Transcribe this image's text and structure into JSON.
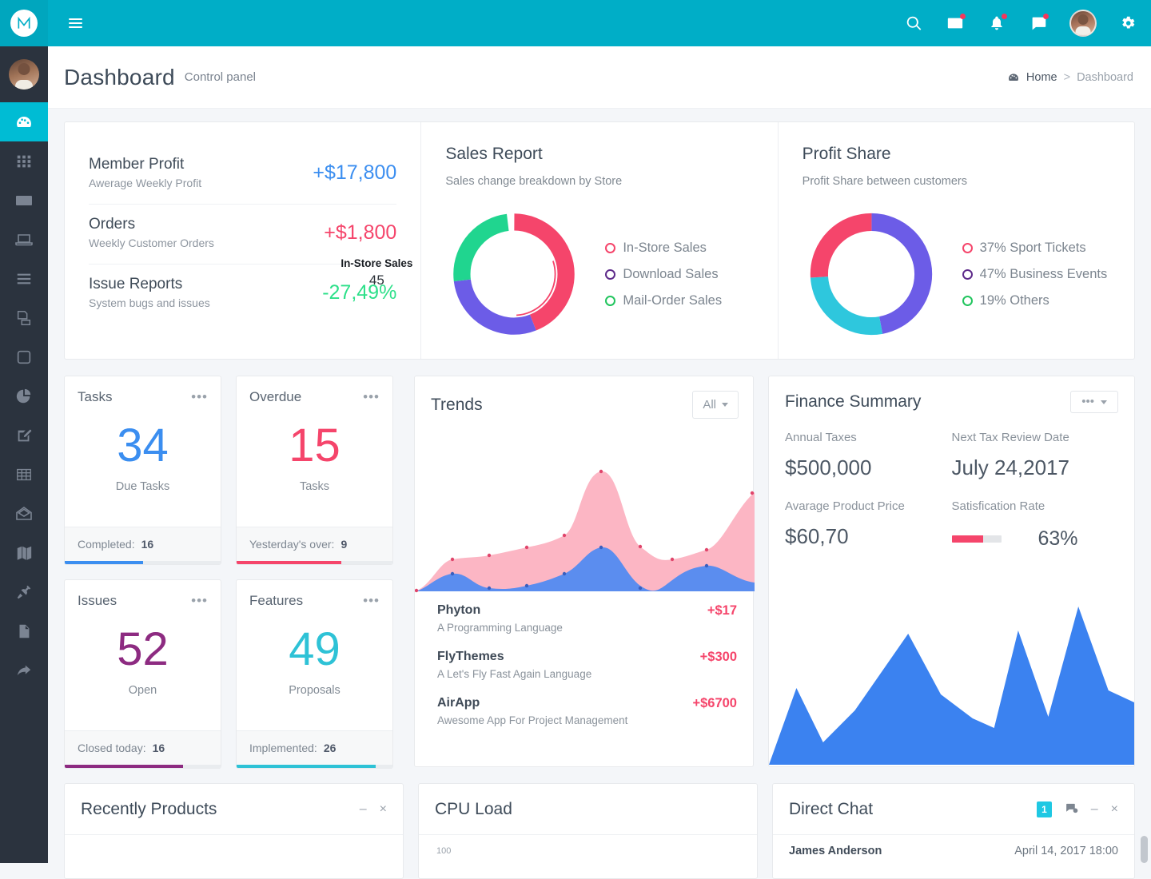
{
  "navbar": {
    "logo_name": "brand-logo",
    "icons": [
      "search-icon",
      "envelope-icon",
      "bell-icon",
      "chat-icon",
      "gear-icon"
    ],
    "brand_color": "#00aec7"
  },
  "sidebar": {
    "items": [
      {
        "icon": "dashboard-icon",
        "active": true
      },
      {
        "icon": "grid-icon",
        "active": false
      },
      {
        "icon": "envelope-icon",
        "active": false
      },
      {
        "icon": "laptop-icon",
        "active": false
      },
      {
        "icon": "bars-icon",
        "active": false
      },
      {
        "icon": "copy-icon",
        "active": false
      },
      {
        "icon": "square-icon",
        "active": false
      },
      {
        "icon": "pie-chart-icon",
        "active": false
      },
      {
        "icon": "edit-icon",
        "active": false
      },
      {
        "icon": "table-icon",
        "active": false
      },
      {
        "icon": "open-envelope-icon",
        "active": false
      },
      {
        "icon": "map-icon",
        "active": false
      },
      {
        "icon": "plug-icon",
        "active": false
      },
      {
        "icon": "file-icon",
        "active": false
      },
      {
        "icon": "share-icon",
        "active": false
      }
    ]
  },
  "header": {
    "title": "Dashboard",
    "subtitle": "Control panel",
    "breadcrumb": {
      "home": "Home",
      "separator": ">",
      "current": "Dashboard"
    }
  },
  "stats": [
    {
      "name": "Member Profit",
      "desc": "Awerage Weekly Profit",
      "value": "+$17,800",
      "color": "#3b8ef0"
    },
    {
      "name": "Orders",
      "desc": "Weekly Customer Orders",
      "value": "+$1,800",
      "color": "#f5456b"
    },
    {
      "name": "Issue Reports",
      "desc": "System bugs and issues",
      "value": "-27,49%",
      "color": "#2ee08a"
    }
  ],
  "sales_report": {
    "title": "Sales Report",
    "subtitle": "Sales change breakdown by Store",
    "center_label": "In-Store Sales",
    "center_value": "45",
    "legend": [
      {
        "label": "In-Store Sales",
        "color": "#f5456b"
      },
      {
        "label": "Download Sales",
        "color": "#5e2b8a"
      },
      {
        "label": "Mail-Order Sales",
        "color": "#22c55e"
      }
    ]
  },
  "profit_share": {
    "title": "Profit Share",
    "subtitle": "Profit Share between customers",
    "legend": [
      {
        "label": "37% Sport Tickets",
        "color": "#f5456b"
      },
      {
        "label": "47% Business Events",
        "color": "#5e2b8a"
      },
      {
        "label": "19% Others",
        "color": "#22c55e"
      }
    ]
  },
  "mini_cards": [
    {
      "title": "Tasks",
      "number": "34",
      "label": "Due Tasks",
      "foot_label": "Completed:",
      "foot_value": "16",
      "color": "#3b8ef0",
      "bar_pct": 50
    },
    {
      "title": "Overdue",
      "number": "15",
      "label": "Tasks",
      "foot_label": "Yesterday's over:",
      "foot_value": "9",
      "color": "#f5456b",
      "bar_pct": 67
    },
    {
      "title": "Issues",
      "number": "52",
      "label": "Open",
      "foot_label": "Closed today:",
      "foot_value": "16",
      "color": "#8d2b81",
      "bar_pct": 76
    },
    {
      "title": "Features",
      "number": "49",
      "label": "Proposals",
      "foot_label": "Implemented:",
      "foot_value": "26",
      "color": "#2ec2d6",
      "bar_pct": 89
    }
  ],
  "trends": {
    "title": "Trends",
    "filter_label": "All",
    "items": [
      {
        "name": "Phyton",
        "desc": "A Programming Language",
        "amount": "+$17"
      },
      {
        "name": "FlyThemes",
        "desc": "A Let's Fly Fast Again Language",
        "amount": "+$300"
      },
      {
        "name": "AirApp",
        "desc": "Awesome App For Project Management",
        "amount": "+$6700"
      }
    ]
  },
  "finance": {
    "title": "Finance Summary",
    "cells": [
      {
        "label": "Annual Taxes",
        "value": "$500,000"
      },
      {
        "label": "Next Tax Review Date",
        "value": "July 24,2017"
      },
      {
        "label": "Avarage Product Price",
        "value": "$60,70"
      },
      {
        "label": "Satisfication Rate",
        "value": "63%",
        "pct": 63
      }
    ]
  },
  "bottom": {
    "recently_products": {
      "title": "Recently Products",
      "minimize": "–",
      "close": "×"
    },
    "cpu_load": {
      "title": "CPU Load",
      "axis_top": "100"
    },
    "direct_chat": {
      "title": "Direct Chat",
      "badge": "1",
      "message_author": "James Anderson",
      "message_time": "April 14, 2017 18:00",
      "minimize": "–",
      "close": "×"
    }
  },
  "chart_data": [
    {
      "type": "pie",
      "title": "Sales Report",
      "subtitle": "Sales change breakdown by Store",
      "labels": [
        "In-Store Sales",
        "Download Sales",
        "Mail-Order Sales"
      ],
      "values": [
        45,
        30,
        25
      ],
      "colors": [
        "#f5456b",
        "#6c5ce7",
        "#20d58f"
      ],
      "center_text": "In-Store Sales",
      "center_value": 45,
      "donut": true,
      "legend_position": "right"
    },
    {
      "type": "pie",
      "title": "Profit Share",
      "subtitle": "Profit Share between customers",
      "labels": [
        "Sport Tickets",
        "Business Events",
        "Others"
      ],
      "values": [
        37,
        47,
        19
      ],
      "colors": [
        "#f5456b",
        "#6c5ce7",
        "#2ec7dd"
      ],
      "donut": true,
      "legend_position": "right"
    },
    {
      "type": "area",
      "title": "Trends",
      "x": [
        0,
        1,
        2,
        3,
        4,
        5,
        6,
        7,
        8,
        9
      ],
      "series": [
        {
          "name": "pink-series",
          "color": "#fcb6c4",
          "values": [
            2,
            24,
            26,
            30,
            46,
            98,
            50,
            30,
            44,
            93
          ]
        },
        {
          "name": "blue-series",
          "color": "#5b8def",
          "values": [
            2,
            20,
            8,
            6,
            12,
            46,
            26,
            5,
            30,
            14
          ]
        }
      ],
      "ylim": [
        0,
        100
      ],
      "grid": false,
      "legend_position": "none"
    },
    {
      "type": "area",
      "title": "Finance Summary",
      "x": [
        0,
        1,
        2,
        3,
        4,
        5,
        6,
        7,
        8,
        9,
        10,
        11
      ],
      "series": [
        {
          "name": "finance-series",
          "color": "#3b82f0",
          "values": [
            0,
            35,
            10,
            26,
            62,
            40,
            28,
            22,
            75,
            18,
            92,
            45
          ]
        }
      ],
      "ylim": [
        0,
        100
      ],
      "grid": false,
      "legend_position": "none"
    }
  ]
}
